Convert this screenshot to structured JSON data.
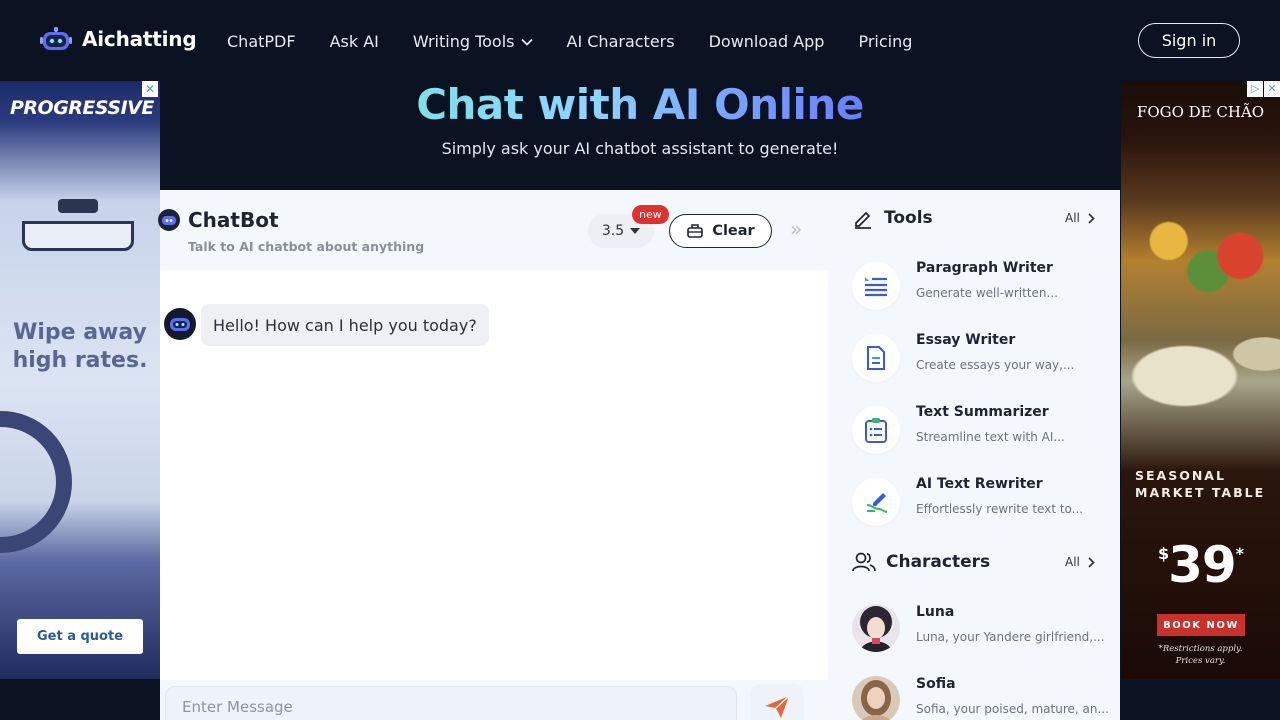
{
  "nav": {
    "logo_text": "Aichatting",
    "links": [
      {
        "label": "ChatPDF"
      },
      {
        "label": "Ask AI"
      },
      {
        "label": "Writing Tools"
      },
      {
        "label": "AI Characters"
      },
      {
        "label": "Download App"
      },
      {
        "label": "Pricing"
      }
    ],
    "signin_label": "Sign in"
  },
  "hero": {
    "title_part1": "Chat with AI ",
    "title_part2": "Online",
    "subtitle": "Simply ask your AI chatbot assistant to generate!"
  },
  "ad_left": {
    "brand": "PROGRESSIVE",
    "headline_line1": "Wipe away",
    "headline_line2": "high rates.",
    "cta": "Get a quote",
    "close": "✕"
  },
  "ad_right": {
    "brand": "FOGO DE CHÃO",
    "tagline_line1": "SEASONAL",
    "tagline_line2": "MARKET TABLE",
    "price_symbol": "$",
    "price": "39",
    "price_mark": "*",
    "cta": "BOOK NOW",
    "fine_line1": "*Restrictions apply.",
    "fine_line2": "Prices vary.",
    "close": "✕"
  },
  "chat": {
    "title": "ChatBot",
    "subtitle": "Talk to AI chatbot about anything",
    "model": "3.5",
    "new_badge": "new",
    "clear_label": "Clear",
    "greeting": "Hello! How can I help you today?",
    "input_placeholder": "Enter Message"
  },
  "tools": {
    "title": "Tools",
    "all_label": "All",
    "items": [
      {
        "name": "Paragraph Writer",
        "desc": "Generate well-written...",
        "icon": "paragraph-icon"
      },
      {
        "name": "Essay Writer",
        "desc": "Create essays your way,...",
        "icon": "document-icon"
      },
      {
        "name": "Text Summarizer",
        "desc": "Streamline text with AI...",
        "icon": "clipboard-list-icon"
      },
      {
        "name": "AI Text Rewriter",
        "desc": "Effortlessly rewrite text to...",
        "icon": "rewrite-pen-icon"
      }
    ]
  },
  "characters": {
    "title": "Characters",
    "all_label": "All",
    "items": [
      {
        "name": "Luna",
        "desc": "Luna, your Yandere girlfriend,..."
      },
      {
        "name": "Sofia",
        "desc": "Sofia, your poised, mature, an..."
      }
    ]
  },
  "colors": {
    "background": "#0b1221",
    "panel": "#f4f8fd",
    "accent_blue": "#3a5bd9",
    "badge_red": "#e0312f",
    "send_orange": "#e8663d"
  }
}
